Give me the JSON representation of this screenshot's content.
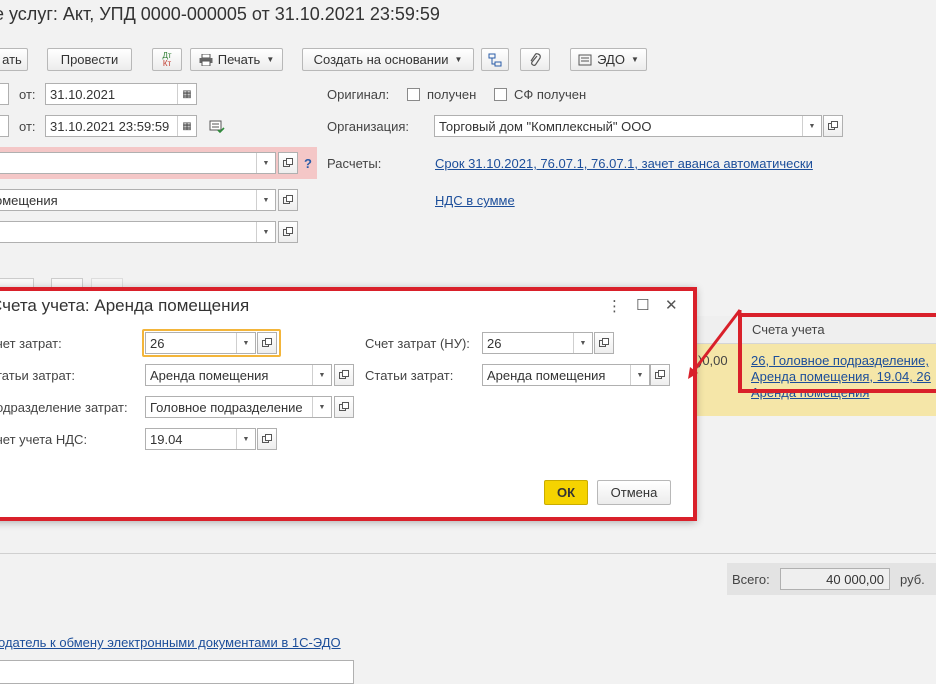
{
  "title": "е услуг: Акт, УПД 0000-000005 от 31.10.2021 23:59:59",
  "toolbar": {
    "post_close": "ать",
    "post": "Провести",
    "dtkt": "ДтКт",
    "print": "Печать",
    "create_based": "Создать на основании",
    "edo": "ЭДО"
  },
  "header": {
    "ot1_label": "от:",
    "ot1_value": "31.10.2021",
    "ot2_label": "от:",
    "ot2_value": "31.10.2021 23:59:59",
    "original_label": "Оригинал:",
    "received_label": "получен",
    "sf_received_label": "СФ получен",
    "org_label": "Организация:",
    "org_value": "Торговый дом \"Комплексный\" ООО",
    "calc_label": "Расчеты:",
    "calc_link": "Срок 31.10.2021, 76.07.1, 76.07.1, зачет аванса автоматически",
    "vat_link": "НДС в сумме",
    "contract_value": "омещения",
    "help": "?"
  },
  "table": {
    "col_accounts": "Счета учета",
    "amount_fragment": ")0,00",
    "accounts_cell": [
      "26, Головное подразделение,",
      "Аренда помещения, 19.04, 26",
      "Аренда помещения"
    ]
  },
  "dialog": {
    "title": "Счета учета: Аренда помещения",
    "cost_account_label": "чет затрат:",
    "cost_account_value": "26",
    "cost_items_label": "татьи затрат:",
    "cost_items_value": "Аренда помещения",
    "division_label": "одразделение затрат:",
    "division_value": "Головное подразделение",
    "vat_account_label": "чет учета НДС:",
    "vat_account_value": "19.04",
    "cost_account_nu_label": "Счет затрат (НУ):",
    "cost_account_nu_value": "26",
    "cost_items2_label": "Статьи затрат:",
    "cost_items2_value": "Аренда помещения",
    "ok": "ОК",
    "cancel": "Отмена",
    "menu": "⋮",
    "maximize": "☐",
    "close": "✕"
  },
  "footer": {
    "total_label": "Всего:",
    "total_value": "40 000,00",
    "currency": "руб.",
    "edo_link": "одатель к обмену электронными документами в 1С-ЭДО"
  },
  "colors": {
    "highlight": "#d9202a",
    "ok_button": "#f5d300",
    "row_yellow": "#f5e6a8"
  }
}
